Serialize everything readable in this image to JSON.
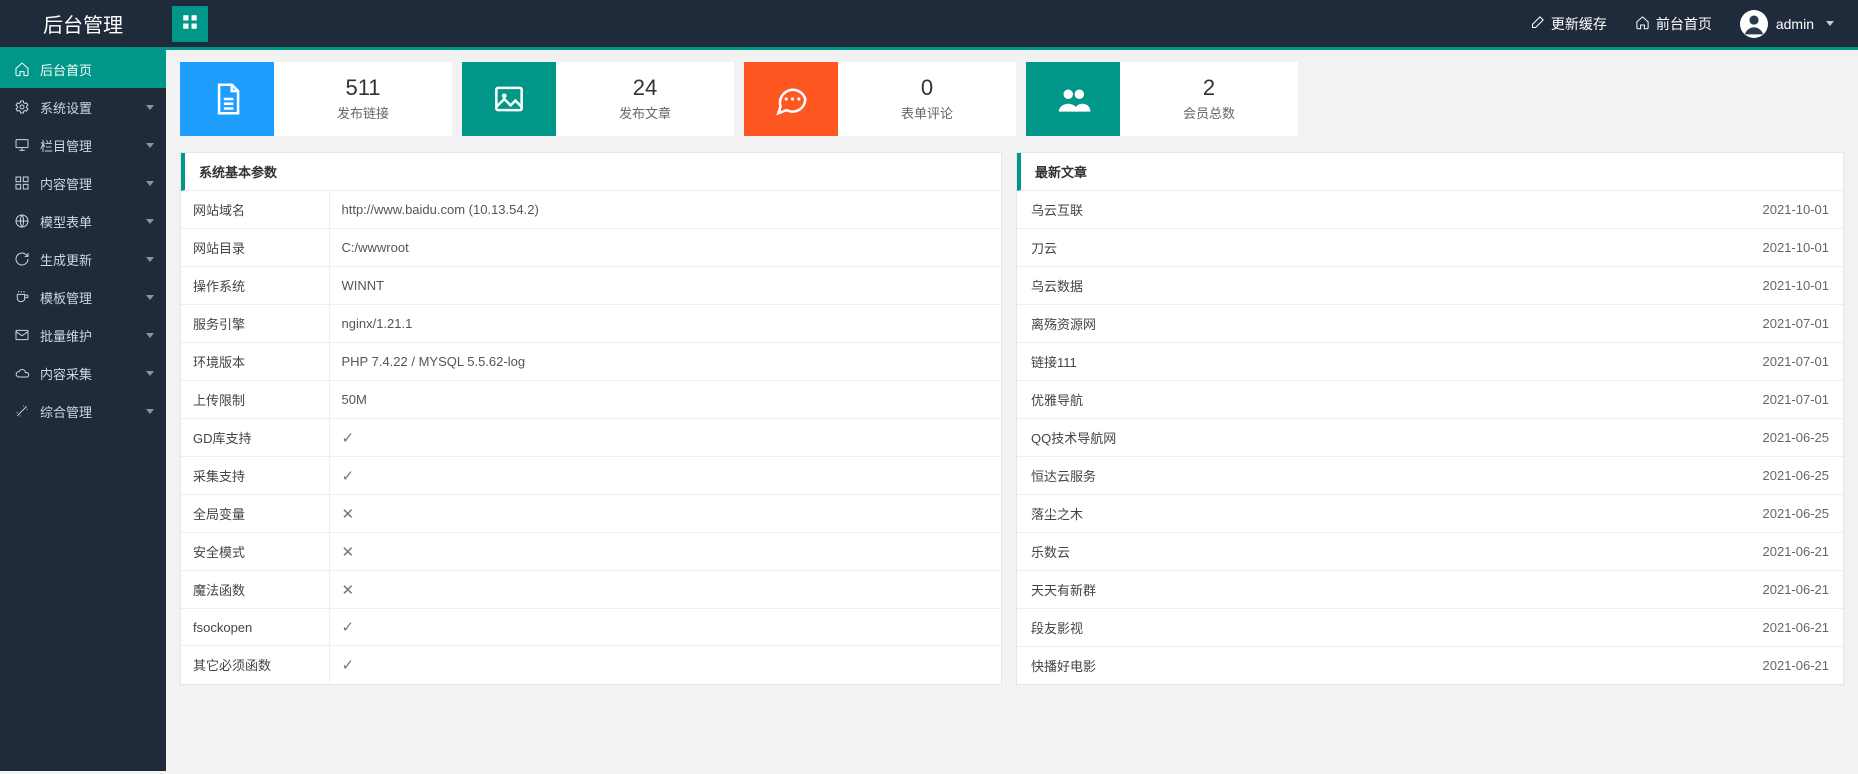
{
  "header": {
    "brand": "后台管理",
    "refresh_cache": "更新缓存",
    "front_home": "前台首页",
    "username": "admin"
  },
  "sidebar": {
    "items": [
      {
        "label": "后台首页",
        "icon": "home",
        "expandable": false,
        "active": true
      },
      {
        "label": "系统设置",
        "icon": "gear",
        "expandable": true
      },
      {
        "label": "栏目管理",
        "icon": "monitor",
        "expandable": true
      },
      {
        "label": "内容管理",
        "icon": "grid",
        "expandable": true
      },
      {
        "label": "模型表单",
        "icon": "globe",
        "expandable": true
      },
      {
        "label": "生成更新",
        "icon": "refresh",
        "expandable": true
      },
      {
        "label": "模板管理",
        "icon": "cup",
        "expandable": true
      },
      {
        "label": "批量维护",
        "icon": "mail",
        "expandable": true
      },
      {
        "label": "内容采集",
        "icon": "cloud",
        "expandable": true
      },
      {
        "label": "综合管理",
        "icon": "wand",
        "expandable": true
      }
    ]
  },
  "stats": [
    {
      "value": "511",
      "label": "发布链接",
      "color": "c-blue",
      "icon": "doc"
    },
    {
      "value": "24",
      "label": "发布文章",
      "color": "c-teal",
      "icon": "image"
    },
    {
      "value": "0",
      "label": "表单评论",
      "color": "c-orange",
      "icon": "chat"
    },
    {
      "value": "2",
      "label": "会员总数",
      "color": "c-teal",
      "icon": "users"
    }
  ],
  "params": {
    "title": "系统基本参数",
    "rows": [
      {
        "k": "网站域名",
        "v": "http://www.baidu.com (10.13.54.2)",
        "type": "text"
      },
      {
        "k": "网站目录",
        "v": "C:/wwwroot",
        "type": "text"
      },
      {
        "k": "操作系统",
        "v": "WINNT",
        "type": "text"
      },
      {
        "k": "服务引擎",
        "v": "nginx/1.21.1",
        "type": "text"
      },
      {
        "k": "环境版本",
        "v": "PHP 7.4.22 / MYSQL 5.5.62-log",
        "type": "text"
      },
      {
        "k": "上传限制",
        "v": "50M",
        "type": "text"
      },
      {
        "k": "GD库支持",
        "v": "true",
        "type": "bool"
      },
      {
        "k": "采集支持",
        "v": "true",
        "type": "bool"
      },
      {
        "k": "全局变量",
        "v": "false",
        "type": "bool"
      },
      {
        "k": "安全模式",
        "v": "false",
        "type": "bool"
      },
      {
        "k": "魔法函数",
        "v": "false",
        "type": "bool"
      },
      {
        "k": "fsockopen",
        "v": "true",
        "type": "bool"
      },
      {
        "k": "其它必须函数",
        "v": "true",
        "type": "bool"
      }
    ]
  },
  "articles": {
    "title": "最新文章",
    "rows": [
      {
        "title": "乌云互联",
        "date": "2021-10-01"
      },
      {
        "title": "刀云",
        "date": "2021-10-01"
      },
      {
        "title": "乌云数据",
        "date": "2021-10-01"
      },
      {
        "title": "离殇资源网",
        "date": "2021-07-01"
      },
      {
        "title": "链接111",
        "date": "2021-07-01"
      },
      {
        "title": "优雅导航",
        "date": "2021-07-01"
      },
      {
        "title": "QQ技术导航网",
        "date": "2021-06-25"
      },
      {
        "title": "恒达云服务",
        "date": "2021-06-25"
      },
      {
        "title": "落尘之木",
        "date": "2021-06-25"
      },
      {
        "title": "乐数云",
        "date": "2021-06-21"
      },
      {
        "title": "天天有新群",
        "date": "2021-06-21"
      },
      {
        "title": "段友影视",
        "date": "2021-06-21"
      },
      {
        "title": "快播好电影",
        "date": "2021-06-21"
      }
    ]
  }
}
